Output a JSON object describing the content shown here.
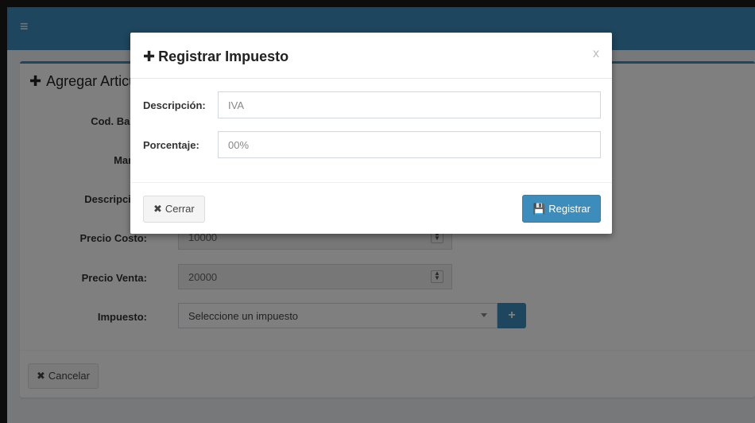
{
  "topbar": {
    "menu_icon": "hamburger-icon"
  },
  "box": {
    "title": "Agregar Articulo",
    "title_icon": "plus-icon",
    "fields": {
      "cod_barra_label": "Cod. Barra:",
      "marca_label": "Marca:",
      "descripcion_label": "Descripción:",
      "precio_costo_label": "Precio Costo:",
      "precio_costo_value": "10000",
      "precio_venta_label": "Precio Venta:",
      "precio_venta_value": "20000",
      "impuesto_label": "Impuesto:",
      "impuesto_selected": "Seleccione un impuesto"
    },
    "add_impuesto_label": "+",
    "cancel_label": "Cancelar"
  },
  "modal": {
    "title": "Registrar Impuesto",
    "close_label": "x",
    "descripcion_label": "Descripción:",
    "descripcion_value": "IVA",
    "porcentaje_label": "Porcentaje:",
    "porcentaje_placeholder": "00%",
    "cancel_label": "Cerrar",
    "submit_label": "Registrar"
  },
  "colors": {
    "primary": "#3c8dbc",
    "overlay": "rgba(0,0,0,0.5)"
  }
}
